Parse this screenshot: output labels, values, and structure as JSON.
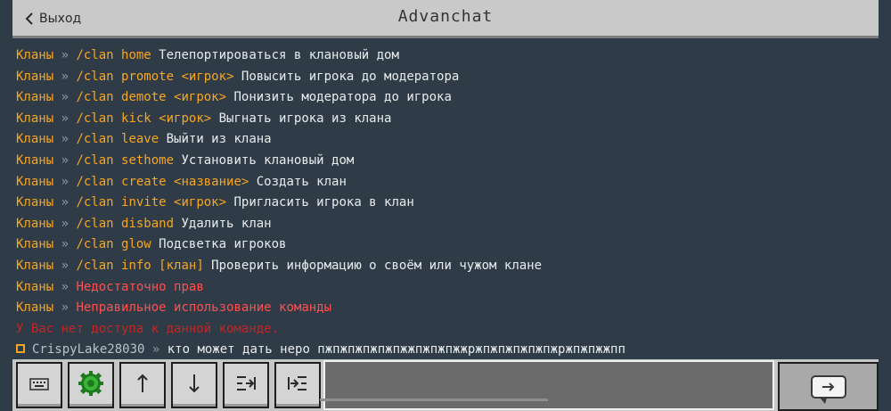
{
  "header": {
    "back_label": "Выход",
    "title": "Advanchat"
  },
  "chat": {
    "help_lines": [
      {
        "prefix": "Кланы",
        "sep": " » ",
        "cmd": "/clan home",
        "desc": " Телепортироваться в клановый дом"
      },
      {
        "prefix": "Кланы",
        "sep": " » ",
        "cmd": "/clan promote <игрок>",
        "desc": " Повысить игрока до модератора"
      },
      {
        "prefix": "Кланы",
        "sep": " » ",
        "cmd": "/clan demote <игрок>",
        "desc": " Понизить модератора до игрока"
      },
      {
        "prefix": "Кланы",
        "sep": " » ",
        "cmd": "/clan kick <игрок>",
        "desc": " Выгнать игрока из клана"
      },
      {
        "prefix": "Кланы",
        "sep": " » ",
        "cmd": "/clan leave",
        "desc": " Выйти из клана"
      },
      {
        "prefix": "Кланы",
        "sep": " » ",
        "cmd": "/clan sethome",
        "desc": " Установить клановый дом"
      },
      {
        "prefix": "Кланы",
        "sep": " » ",
        "cmd": "/clan create <название>",
        "desc": " Создать клан"
      },
      {
        "prefix": "Кланы",
        "sep": " » ",
        "cmd": "/clan invite <игрок>",
        "desc": " Пригласить игрока в клан"
      },
      {
        "prefix": "Кланы",
        "sep": " » ",
        "cmd": "/clan disband",
        "desc": " Удалить клан"
      },
      {
        "prefix": "Кланы",
        "sep": " » ",
        "cmd": "/clan glow",
        "desc": " Подсветка игроков"
      },
      {
        "prefix": "Кланы",
        "sep": " » ",
        "cmd": "/clan info [клан]",
        "desc": "  Проверить информацию о своём или чужом клане"
      }
    ],
    "error_lines": [
      {
        "prefix": "Кланы",
        "sep": " » ",
        "text": "Недостаточно прав"
      },
      {
        "prefix": "Кланы",
        "sep": " » ",
        "text": "Неправильное использование команды"
      }
    ],
    "no_access_line": "У Вас нет доступа к данной команде.",
    "player_message": {
      "player": "CrispyLake28030",
      "sep": " »  ",
      "text": "кто может дать неро пжпжпжпжпжпжжпжпжпжжржпжпжпжпжпжржпжпжжпп"
    }
  },
  "toolbar": {
    "buttons": [
      {
        "name": "keyboard-button",
        "icon": "keyboard-icon"
      },
      {
        "name": "emote-button",
        "icon": "green-gear-icon"
      },
      {
        "name": "history-up-button",
        "icon": "arrow-up-icon"
      },
      {
        "name": "history-down-button",
        "icon": "arrow-down-icon"
      },
      {
        "name": "collapse-button",
        "icon": "collapse-icon"
      },
      {
        "name": "expand-button",
        "icon": "expand-icon"
      }
    ],
    "input_value": "",
    "send_icon": "send-arrow-icon"
  },
  "colors": {
    "background": "#2f3b47",
    "prefix": "#f5a623",
    "separator": "#8c98a4",
    "description": "#e8ecef",
    "error": "#ff5050",
    "no_access": "#e02020",
    "header": "#c9c9c9",
    "toolbar": "#c6c6c6"
  }
}
